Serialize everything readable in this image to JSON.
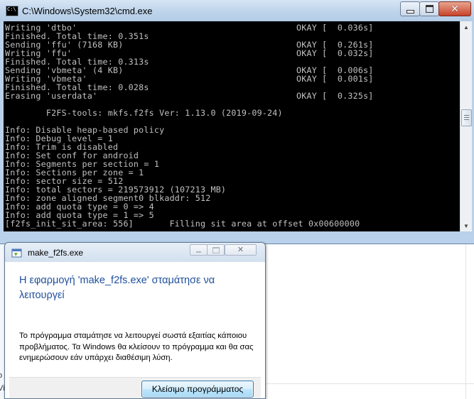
{
  "cmd_window": {
    "title": "C:\\Windows\\System32\\cmd.exe",
    "icon_text": "C:\\",
    "lines": [
      {
        "text": "Writing 'dtbo'",
        "status": "OKAY [  0.036s]"
      },
      {
        "text": "Finished. Total time: 0.351s",
        "status": ""
      },
      {
        "text": "Sending 'ffu' (7168 KB)",
        "status": "OKAY [  0.261s]"
      },
      {
        "text": "Writing 'ffu'",
        "status": "OKAY [  0.032s]"
      },
      {
        "text": "Finished. Total time: 0.313s",
        "status": ""
      },
      {
        "text": "Sending 'vbmeta' (4 KB)",
        "status": "OKAY [  0.006s]"
      },
      {
        "text": "Writing 'vbmeta'",
        "status": "OKAY [  0.001s]"
      },
      {
        "text": "Finished. Total time: 0.028s",
        "status": ""
      },
      {
        "text": "Erasing 'userdata'",
        "status": "OKAY [  0.325s]"
      },
      {
        "text": "",
        "status": ""
      },
      {
        "text": "        F2FS-tools: mkfs.f2fs Ver: 1.13.0 (2019-09-24)",
        "status": ""
      },
      {
        "text": "",
        "status": ""
      },
      {
        "text": "Info: Disable heap-based policy",
        "status": ""
      },
      {
        "text": "Info: Debug level = 1",
        "status": ""
      },
      {
        "text": "Info: Trim is disabled",
        "status": ""
      },
      {
        "text": "Info: Set conf for android",
        "status": ""
      },
      {
        "text": "Info: Segments per section = 1",
        "status": ""
      },
      {
        "text": "Info: Sections per zone = 1",
        "status": ""
      },
      {
        "text": "Info: sector size = 512",
        "status": ""
      },
      {
        "text": "Info: total sectors = 219573912 (107213 MB)",
        "status": ""
      },
      {
        "text": "Info: zone aligned segment0 blkaddr: 512",
        "status": ""
      },
      {
        "text": "Info: add quota type = 0 => 4",
        "status": ""
      },
      {
        "text": "Info: add quota type = 1 => 5",
        "status": ""
      },
      {
        "text": "[f2fs_init_sit_area: 556]       Filling sit area at offset 0x00600000",
        "status": ""
      }
    ]
  },
  "dialog": {
    "title": "make_f2fs.exe",
    "heading": "Η εφαρμογή 'make_f2fs.exe' σταμάτησε να λειτουργεί",
    "message": "Το πρόγραμμα σταμάτησε να λειτουργεί σωστά εξαιτίας κάποιου προβλήματος. Τα Windows θα κλείσουν το πρόγραμμα και θα σας ενημερώσουν εάν υπάρχει διαθέσιμη λύση.",
    "close_button": "Κλείσιμο προγράμματος"
  },
  "background": {
    "fragment_1": "ο",
    "fragment_2": "Vi"
  },
  "colors": {
    "console_bg": "#000000",
    "console_text": "#c0c0c0",
    "dialog_heading": "#1f4f9c",
    "frame": "#b9d1ea"
  }
}
